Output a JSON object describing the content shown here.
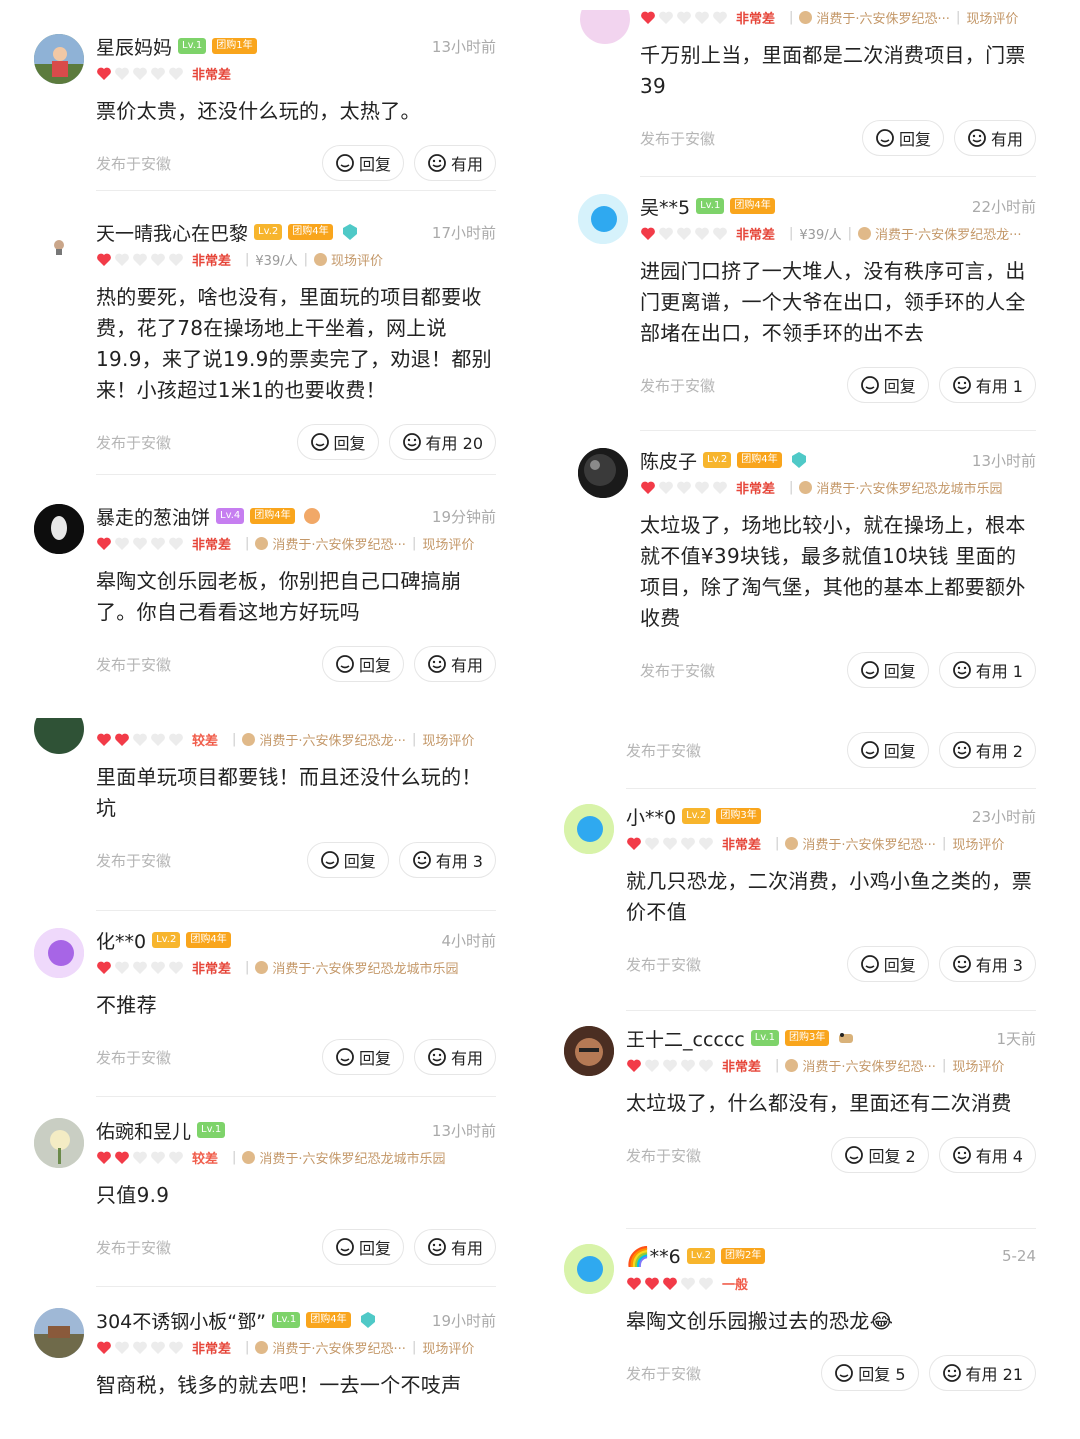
{
  "common": {
    "location": "发布于安徽",
    "reply": "回复",
    "useful": "有用"
  },
  "left": [
    {
      "user": "星辰妈妈",
      "level": "Lv.1",
      "buy": "团购1年",
      "time": "13小时前",
      "stars": 1,
      "rating": "非常差",
      "price": "",
      "store": "",
      "review": "",
      "text": "票价太贵，还没什么玩的，太热了。",
      "reply": "回复",
      "useful": "有用"
    },
    {
      "user": "天一晴我心在巴黎",
      "level": "Lv.2",
      "buy": "团购4年",
      "time": "17小时前",
      "stars": 1,
      "rating": "非常差",
      "price": "¥39/人",
      "store": "",
      "review": "现场评价",
      "text": "热的要死，啥也没有，里面玩的项目都要收费，花了78在操场地上干坐着，网上说19.9，来了说19.9的票卖完了，劝退！都别来！小孩超过1米1的也要收费！",
      "reply": "回复",
      "useful": "有用 20"
    },
    {
      "user": "暴走的葱油饼",
      "level": "Lv.4",
      "buy": "团购4年",
      "time": "19分钟前",
      "stars": 1,
      "rating": "非常差",
      "price": "",
      "store": "消费于·六安侏罗纪恐···",
      "review": "现场评价",
      "text": "皋陶文创乐园老板，你别把自己口碑搞崩了。你自己看看这地方好玩吗",
      "reply": "回复",
      "useful": "有用"
    },
    {
      "user": "",
      "level": "",
      "buy": "",
      "time": "",
      "stars": 2,
      "rating": "较差",
      "price": "",
      "store": "消费于·六安侏罗纪恐龙···",
      "review": "现场评价",
      "text": "里面单玩项目都要钱！而且还没什么玩的！坑",
      "reply": "回复",
      "useful": "有用 3"
    },
    {
      "user": "化**0",
      "level": "Lv.2",
      "buy": "团购4年",
      "time": "4小时前",
      "stars": 1,
      "rating": "非常差",
      "price": "",
      "store": "消费于·六安侏罗纪恐龙城市乐园",
      "review": "",
      "text": "不推荐",
      "reply": "回复",
      "useful": "有用"
    },
    {
      "user": "佑豌和昱儿",
      "level": "Lv.1",
      "buy": "",
      "time": "13小时前",
      "stars": 2,
      "rating": "较差",
      "price": "",
      "store": "消费于·六安侏罗纪恐龙城市乐园",
      "review": "",
      "text": "只值9.9",
      "reply": "回复",
      "useful": "有用"
    },
    {
      "user": "304不诱钢小板“鄧”",
      "level": "Lv.1",
      "buy": "团购4年",
      "time": "19小时前",
      "stars": 1,
      "rating": "非常差",
      "price": "",
      "store": "消费于·六安侏罗纪恐···",
      "review": "现场评价",
      "text": "智商税，钱多的就去吧！一去一个不吱声",
      "reply": "",
      "useful": ""
    }
  ],
  "right": [
    {
      "user": "",
      "level": "",
      "buy": "",
      "time": "",
      "stars": 1,
      "rating": "非常差",
      "price": "",
      "store": "消费于·六安侏罗纪恐···",
      "review": "现场评价",
      "text": "千万别上当，里面都是二次消费项目，门票39",
      "reply": "回复",
      "useful": "有用"
    },
    {
      "user": "吴**5",
      "level": "Lv.1",
      "buy": "团购4年",
      "time": "22小时前",
      "stars": 1,
      "rating": "非常差",
      "price": "¥39/人",
      "store": "消费于·六安侏罗纪恐龙···",
      "review": "",
      "text": "进园门口挤了一大堆人，没有秩序可言，出门更离谱，一个大爷在出口，领手环的人全部堵在出口，不领手环的出不去",
      "reply": "回复",
      "useful": "有用 1"
    },
    {
      "user": "陈皮子",
      "level": "Lv.2",
      "buy": "团购4年",
      "time": "13小时前",
      "stars": 1,
      "rating": "非常差",
      "price": "",
      "store": "消费于·六安侏罗纪恐龙城市乐园",
      "review": "",
      "text": "太垃圾了，场地比较小，就在操场上，根本就不值¥39块钱，最多就值10块钱 里面的项目，除了淘气堡，其他的基本上都要额外收费",
      "reply": "回复",
      "useful": "有用 1"
    },
    {
      "user": "",
      "level": "",
      "buy": "",
      "time": "",
      "stars": 0,
      "rating": "",
      "price": "",
      "store": "",
      "review": "",
      "text": "",
      "reply": "回复",
      "useful": "有用 2"
    },
    {
      "user": "小**0",
      "level": "Lv.2",
      "buy": "团购3年",
      "time": "23小时前",
      "stars": 1,
      "rating": "非常差",
      "price": "",
      "store": "消费于·六安侏罗纪恐···",
      "review": "现场评价",
      "text": "就几只恐龙，二次消费，小鸡小鱼之类的，票价不值",
      "reply": "回复",
      "useful": "有用 3"
    },
    {
      "user": "王十二_ccccc",
      "level": "Lv.1",
      "buy": "团购3年",
      "time": "1天前",
      "stars": 1,
      "rating": "非常差",
      "price": "",
      "store": "消费于·六安侏罗纪恐···",
      "review": "现场评价",
      "text": "太垃圾了，什么都没有，里面还有二次消费",
      "reply": "回复 2",
      "useful": "有用 4"
    },
    {
      "user": "🌈**6",
      "level": "Lv.2",
      "buy": "团购2年",
      "time": "5-24",
      "stars": 3,
      "rating": "一般",
      "price": "",
      "store": "",
      "review": "",
      "text": "皋陶文创乐园搬过去的恐龙😂",
      "reply": "回复 5",
      "useful": "有用 21"
    }
  ]
}
